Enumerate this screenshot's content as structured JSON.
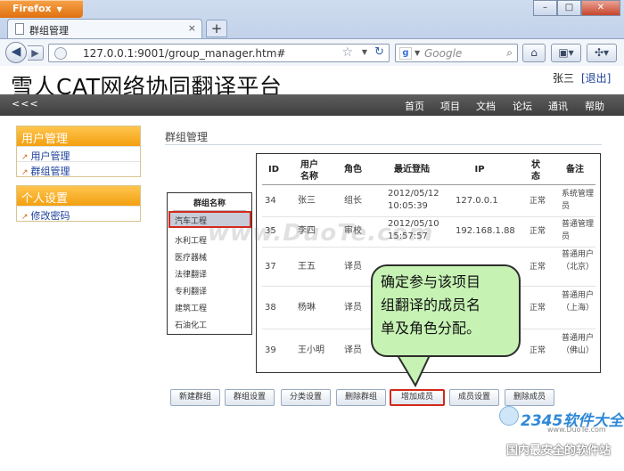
{
  "browser": {
    "app_button": "Firefox",
    "tab_title": "群组管理",
    "new_tab": "+",
    "url": "127.0.0.1:9001/group_manager.htm#",
    "search_placeholder": "Google",
    "tab_close": "×"
  },
  "header": {
    "site_title": "雪人CAT网络协同翻译平台",
    "user_name": "张三",
    "logout": "[退出]"
  },
  "topnav": {
    "collapse": "<<<",
    "items": [
      "首页",
      "项目",
      "文档",
      "论坛",
      "通讯",
      "帮助"
    ]
  },
  "sidebar": {
    "sections": [
      {
        "title": "用户管理",
        "items": [
          "用户管理",
          "群组管理"
        ]
      },
      {
        "title": "个人设置",
        "items": [
          "修改密码"
        ]
      }
    ]
  },
  "main": {
    "section_title": "群组管理",
    "groups": {
      "header": "群组名称",
      "items": [
        "汽车工程",
        "水利工程",
        "医疗器械",
        "法律翻译",
        "专利翻译",
        "建筑工程",
        "石油化工"
      ],
      "selected_index": 0
    },
    "members": {
      "columns": [
        "ID",
        "用户名称",
        "角色",
        "最近登陆",
        "IP",
        "状态",
        "备注"
      ],
      "rows": [
        {
          "id": "34",
          "name": "张三",
          "role": "组长",
          "login": "2012/05/12 10:05:39",
          "ip": "127.0.0.1",
          "status": "正常",
          "note": "系统管理员"
        },
        {
          "id": "35",
          "name": "李四",
          "role": "审校",
          "login": "2012/05/10 15:57:57",
          "ip": "192.168.1.88",
          "status": "正常",
          "note": "普通管理员"
        },
        {
          "id": "37",
          "name": "王五",
          "role": "译员",
          "login": "",
          "ip": "",
          "status": "正常",
          "note": "普通用户（北京）"
        },
        {
          "id": "38",
          "name": "杨琳",
          "role": "译员",
          "login": "",
          "ip": "",
          "status": "正常",
          "note": "普通用户（上海）"
        },
        {
          "id": "39",
          "name": "王小明",
          "role": "译员",
          "login": "",
          "ip": "",
          "status": "正常",
          "note": "普通用户（佛山）"
        }
      ]
    },
    "actions": [
      "新建群组",
      "群组设置",
      "分类设置",
      "删除群组",
      "增加成员",
      "成员设置",
      "删除成员"
    ],
    "highlighted_action": "增加成员"
  },
  "callout": {
    "lines": [
      "确定参与该项目",
      "组翻译的成员名",
      "单及角色分配。"
    ],
    "color": "#c6f2b4"
  },
  "watermarks": {
    "center": "www.DuoTe.com",
    "logo": "2345软件大全",
    "logo_url": "www.DuoTe.com",
    "bottom": "国内最安全的软件站"
  },
  "colors": {
    "accent_orange": "#f3a011",
    "highlight_red": "#d32a1d",
    "nav_dark": "#4a4a4a"
  }
}
